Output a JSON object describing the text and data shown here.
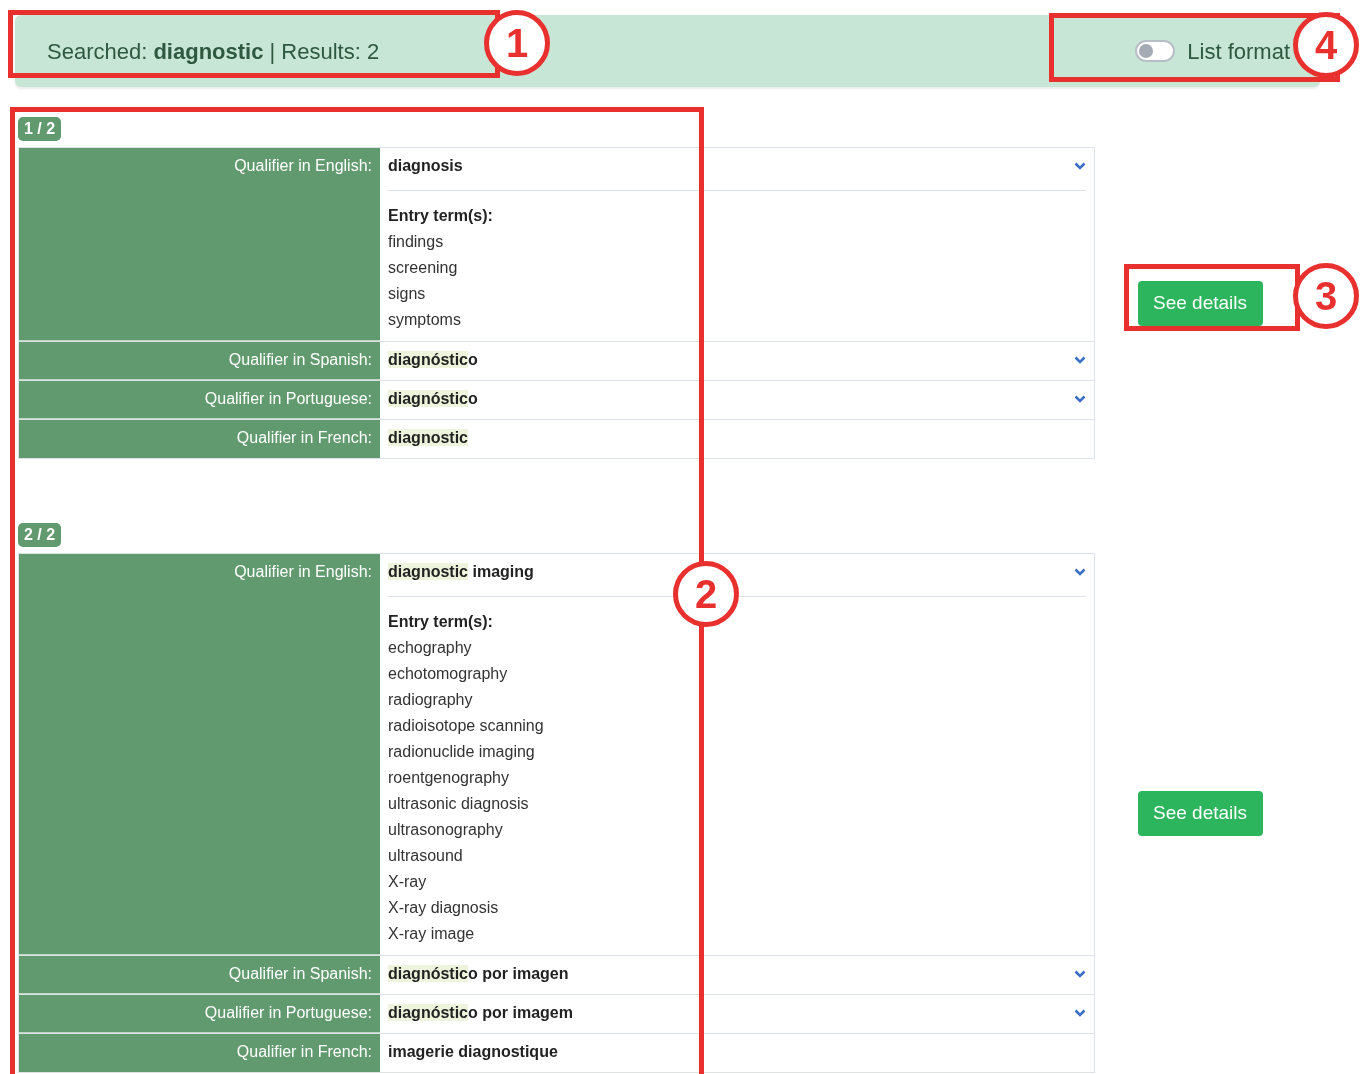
{
  "search_bar": {
    "summary": "Searched: **diagnostic** | Results: 2",
    "list_format_toggle": {
      "label": "List format",
      "on": false
    }
  },
  "results": [
    {
      "badge": "1 / 2",
      "button": "See details",
      "rows": [
        {
          "label": "Qualifier in English:",
          "expandable": true,
          "value": [
            {
              "text": "diagnosis",
              "highlight": false
            }
          ],
          "entry_terms_heading": "Entry term(s):",
          "entry_terms": [
            "findings",
            "screening",
            "signs",
            "symptoms"
          ]
        },
        {
          "label": "Qualifier in Spanish:",
          "expandable": true,
          "value": [
            {
              "text": "diagnóstic",
              "highlight": true
            },
            {
              "text": "o",
              "highlight": false
            }
          ]
        },
        {
          "label": "Qualifier in Portuguese:",
          "expandable": true,
          "value": [
            {
              "text": "diagnóstic",
              "highlight": true
            },
            {
              "text": "o",
              "highlight": false
            }
          ]
        },
        {
          "label": "Qualifier in French:",
          "expandable": false,
          "value": [
            {
              "text": "diagnostic",
              "highlight": true
            }
          ]
        }
      ]
    },
    {
      "badge": "2 / 2",
      "button": "See details",
      "rows": [
        {
          "label": "Qualifier in English:",
          "expandable": true,
          "value": [
            {
              "text": "diagnostic",
              "highlight": true
            },
            {
              "text": " imaging",
              "highlight": false
            }
          ],
          "entry_terms_heading": "Entry term(s):",
          "entry_terms": [
            "echography",
            "echotomography",
            "radiography",
            "radioisotope scanning",
            "radionuclide imaging",
            "roentgenography",
            "ultrasonic diagnosis",
            "ultrasonography",
            "ultrasound",
            "X-ray",
            "X-ray diagnosis",
            "X-ray image"
          ]
        },
        {
          "label": "Qualifier in Spanish:",
          "expandable": true,
          "value": [
            {
              "text": "diagnóstic",
              "highlight": true
            },
            {
              "text": "o por imagen",
              "highlight": false
            }
          ]
        },
        {
          "label": "Qualifier in Portuguese:",
          "expandable": true,
          "value": [
            {
              "text": "diagnóstic",
              "highlight": true
            },
            {
              "text": "o por imagem",
              "highlight": false
            }
          ]
        },
        {
          "label": "Qualifier in French:",
          "expandable": false,
          "value": [
            {
              "text": "imagerie diagnostique",
              "highlight": false
            }
          ]
        }
      ]
    }
  ],
  "annotations": [
    {
      "number": "1"
    },
    {
      "number": "2"
    },
    {
      "number": "3"
    },
    {
      "number": "4"
    }
  ]
}
